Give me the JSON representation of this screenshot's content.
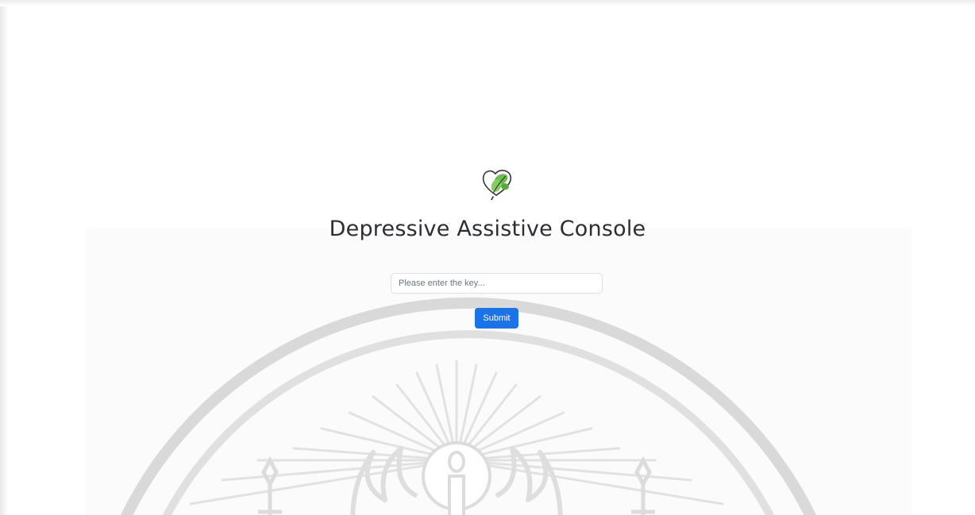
{
  "app": {
    "title": "Depressive Assistive Console"
  },
  "logo": {
    "icon": "leaf-heart-icon",
    "leaf_color": "#6bbd4b",
    "line_color": "#333333"
  },
  "login_form": {
    "key_input": {
      "value": "",
      "placeholder": "Please enter the key..."
    },
    "submit_label": "Submit"
  },
  "background": {
    "watermark": "institution-seal-watermark",
    "seal_color": "#d9d9d9"
  },
  "colors": {
    "accent": "#1a73e8",
    "title_text": "#2b2f33"
  }
}
